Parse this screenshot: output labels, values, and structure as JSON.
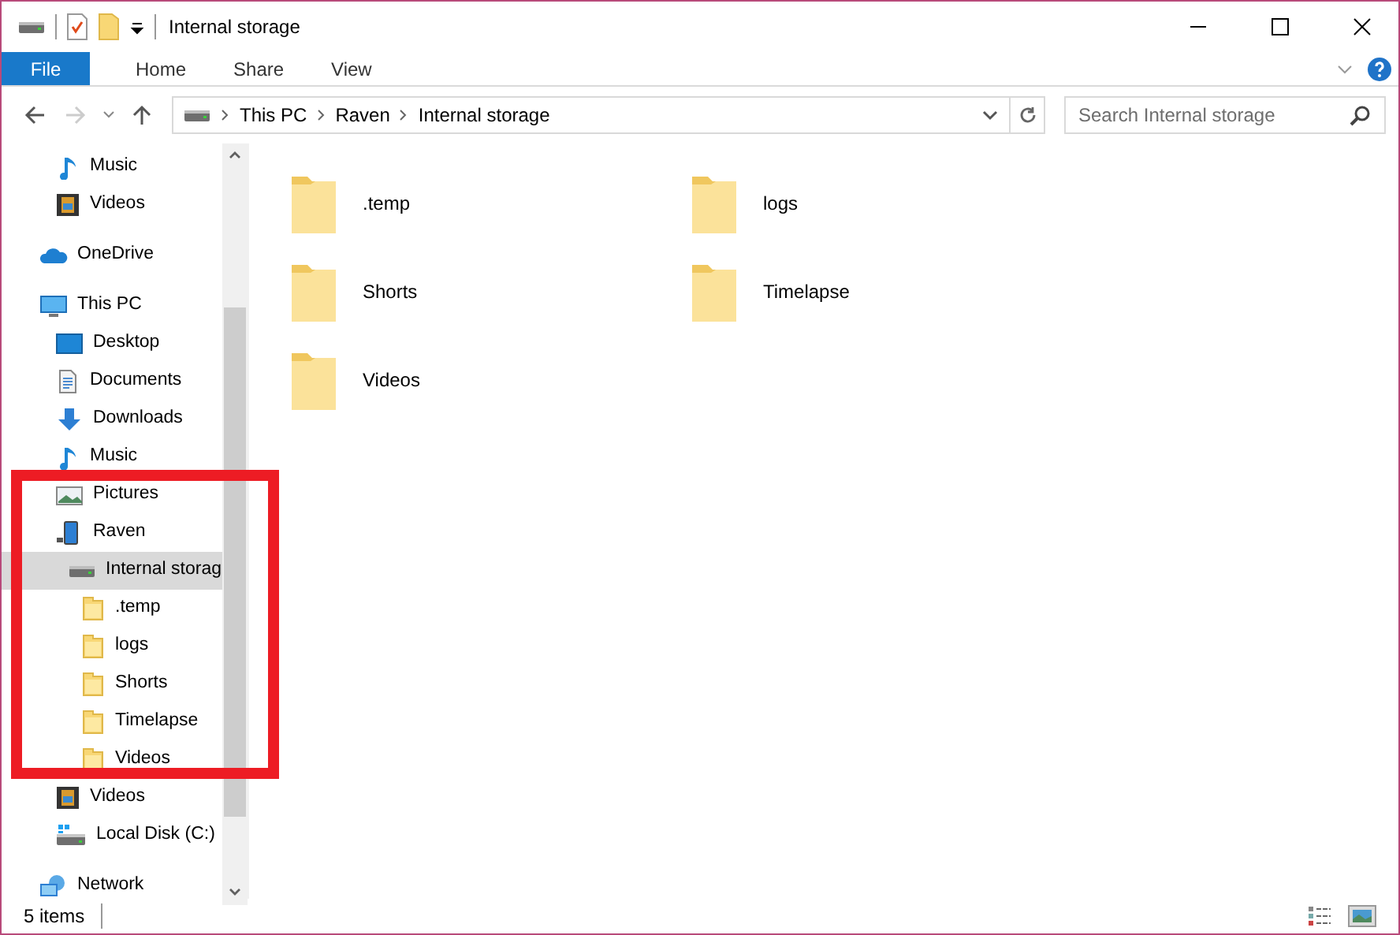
{
  "window": {
    "title": "Internal storage"
  },
  "ribbon_tabs": [
    {
      "label": "File",
      "kind": "file",
      "selected": true
    },
    {
      "label": "Home",
      "kind": "tab",
      "selected": false
    },
    {
      "label": "Share",
      "kind": "tab",
      "selected": false
    },
    {
      "label": "View",
      "kind": "tab",
      "selected": false
    }
  ],
  "address_bar": {
    "path": [
      "This PC",
      "Raven",
      "Internal storage"
    ]
  },
  "search": {
    "placeholder": "Search Internal storage"
  },
  "nav_tree": [
    {
      "children": [
        {
          "label": "Music",
          "kind": "music",
          "selected": false
        },
        {
          "label": "Videos",
          "kind": "video",
          "selected": false
        }
      ]
    },
    {
      "label": "OneDrive",
      "kind": "cloud",
      "selected": false
    },
    {
      "label": "This PC",
      "kind": "pc",
      "selected": false,
      "children": [
        {
          "label": "Desktop",
          "kind": "desktop",
          "selected": false
        },
        {
          "label": "Documents",
          "kind": "documents",
          "selected": false
        },
        {
          "label": "Downloads",
          "kind": "downloads",
          "selected": false
        },
        {
          "label": "Music",
          "kind": "music",
          "selected": false
        },
        {
          "label": "Pictures",
          "kind": "pictures",
          "selected": false
        },
        {
          "label": "Raven",
          "kind": "phone",
          "selected": false,
          "children": [
            {
              "label": "Internal storag",
              "kind": "drive",
              "selected": true,
              "children": [
                {
                  "label": ".temp",
                  "kind": "folder",
                  "selected": false
                },
                {
                  "label": "logs",
                  "kind": "folder",
                  "selected": false
                },
                {
                  "label": "Shorts",
                  "kind": "folder",
                  "selected": false
                },
                {
                  "label": "Timelapse",
                  "kind": "folder",
                  "selected": false
                },
                {
                  "label": "Videos",
                  "kind": "folder",
                  "selected": false
                }
              ]
            }
          ]
        },
        {
          "label": "Videos",
          "kind": "video",
          "selected": false
        },
        {
          "label": "Local Disk (C:)",
          "kind": "disk",
          "selected": false
        }
      ]
    },
    {
      "label": "Network",
      "kind": "network",
      "selected": false
    }
  ],
  "files": [
    {
      "name": ".temp"
    },
    {
      "name": "logs"
    },
    {
      "name": "Shorts"
    },
    {
      "name": "Timelapse"
    },
    {
      "name": "Videos"
    }
  ],
  "status_bar": {
    "item_count": "5 items"
  }
}
